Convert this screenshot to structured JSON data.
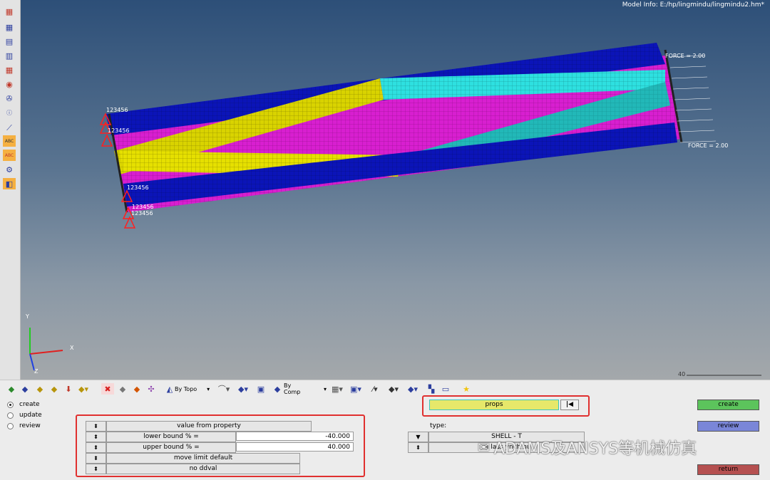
{
  "model_info": "Model Info: E:/hp/lingmindu/lingmindu2.hm*",
  "viewport": {
    "constraint_labels": [
      "123456",
      "123456",
      "123456",
      "123456",
      "123456"
    ],
    "force_labels": [
      "FORCE = 2.00",
      "FORCE = 2.00"
    ],
    "axis": {
      "x": "X",
      "y": "Y",
      "z": "Z"
    },
    "scale_label": "40"
  },
  "colors": {
    "blue": "#0b14b8",
    "magenta": "#d81fd0",
    "yellow": "#d9d300",
    "cyan": "#2ee0e0",
    "create_btn": "#5cc45c",
    "review_btn": "#7a86d8",
    "return_btn": "#b55050",
    "field_yellow": "#e6e86a",
    "accent_red": "#e0302f"
  },
  "left_toolbar_icons": [
    "component-icon",
    "display-icon",
    "mesh-icon",
    "element-icon",
    "view-icon",
    "shade-icon",
    "connector-icon",
    "info-icon",
    "numbers-icon",
    "load-icon",
    "label-abc-icon",
    "label-abc-icon",
    "spring-icon",
    "surface-icon"
  ],
  "toolbar": {
    "by_topo": "By Topo",
    "by_comp": "By Comp"
  },
  "radio": {
    "create": "create",
    "update": "update",
    "review": "review",
    "selected": "create"
  },
  "collector": {
    "label": "props"
  },
  "rows": [
    {
      "label": "value from property",
      "value": ""
    },
    {
      "label": "lower bound % =",
      "value": "-40.000"
    },
    {
      "label": "upper bound % =",
      "value": "40.000"
    },
    {
      "label": "move limit default",
      "value": ""
    },
    {
      "label": "no ddval",
      "value": ""
    }
  ],
  "type": {
    "label": "type:",
    "value": "SHELL - T",
    "sub": "ra   lass   ynch  nu"
  },
  "buttons": {
    "create": "create",
    "review": "review",
    "return": "return"
  },
  "watermark": "ADAMS及ANSYS等机械仿真"
}
